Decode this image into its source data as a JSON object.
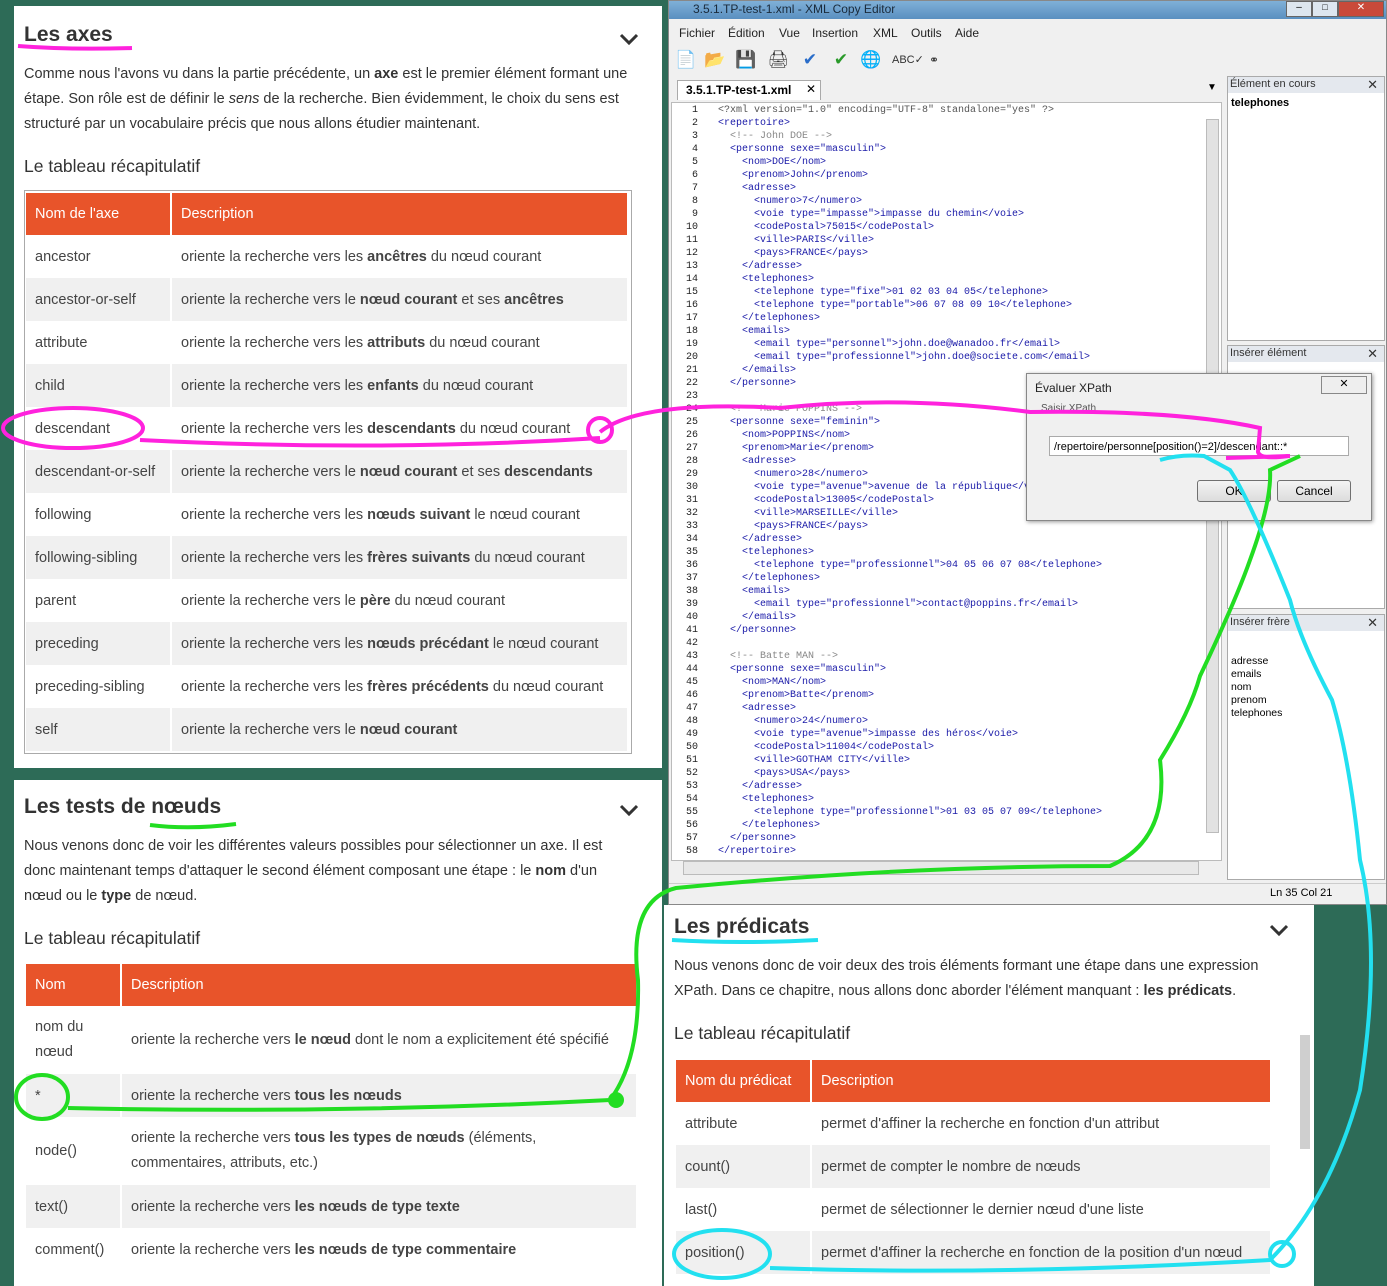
{
  "axes": {
    "title": "Les axes",
    "para1": "Comme nous l'avons vu dans la partie précédente, un",
    "para_bold1": "axe",
    "para2": "est le premier élément formant une étape. Son rôle est de définir le",
    "para_italic": "sens",
    "para3": "de la recherche. Bien évidemment, le choix du sens est structuré par un vocabulaire précis que nous allons étudier maintenant.",
    "subtitle": "Le tableau récapitulatif",
    "headers": [
      "Nom de l'axe",
      "Description"
    ],
    "rows": [
      [
        "ancestor",
        "oriente la recherche vers les ",
        "ancêtres",
        " du nœud courant",
        "",
        ""
      ],
      [
        "ancestor-or-self",
        "oriente la recherche vers le ",
        "nœud courant",
        " et ses ",
        "ancêtres",
        ""
      ],
      [
        "attribute",
        "oriente la recherche vers les ",
        "attributs",
        " du nœud courant",
        "",
        ""
      ],
      [
        "child",
        "oriente la recherche vers les ",
        "enfants",
        " du nœud courant",
        "",
        ""
      ],
      [
        "descendant",
        "oriente la recherche vers les ",
        "descendants",
        " du nœud courant",
        "",
        ""
      ],
      [
        "descendant-or-self",
        "oriente la recherche vers le ",
        "nœud courant",
        " et ses ",
        "descendants",
        ""
      ],
      [
        "following",
        "oriente la recherche vers les ",
        "nœuds suivant",
        " le nœud courant",
        "",
        ""
      ],
      [
        "following-sibling",
        "oriente la recherche vers les ",
        "frères suivants",
        " du nœud courant",
        "",
        ""
      ],
      [
        "parent",
        "oriente la recherche vers le ",
        "père",
        " du nœud courant",
        "",
        ""
      ],
      [
        "preceding",
        "oriente la recherche vers les ",
        "nœuds précédant",
        " le nœud courant",
        "",
        ""
      ],
      [
        "preceding-sibling",
        "oriente la recherche vers les ",
        "frères précédents",
        " du nœud courant",
        "",
        ""
      ],
      [
        "self",
        "oriente la recherche vers le ",
        "nœud courant",
        "",
        "",
        ""
      ]
    ]
  },
  "tests": {
    "title": "Les tests de nœuds",
    "para1": "Nous venons donc de voir les différentes valeurs possibles pour sélectionner un axe. Il est donc maintenant temps d'attaquer le second élément composant une étape : le",
    "bold_nom": "nom",
    "para2": "d'un nœud ou le",
    "bold_type": "type",
    "para3": "de nœud.",
    "subtitle": "Le tableau récapitulatif",
    "headers": [
      "Nom",
      "Description"
    ],
    "rows": [
      [
        "nom du nœud",
        "oriente la recherche vers ",
        "le nœud",
        " dont le nom a explicitement été spécifié"
      ],
      [
        "*",
        "oriente la recherche vers ",
        "tous les nœuds",
        ""
      ],
      [
        "node()",
        "oriente la recherche vers ",
        "tous les types de nœuds",
        " (éléments, commentaires, attributs, etc.)"
      ],
      [
        "text()",
        "oriente la recherche vers ",
        "les nœuds de type texte",
        ""
      ],
      [
        "comment()",
        "oriente la recherche vers ",
        "les nœuds de type commentaire",
        ""
      ]
    ]
  },
  "predicats": {
    "title": "Les prédicats",
    "para1": "Nous venons donc de voir deux des trois éléments formant une étape dans une expression XPath. Dans ce chapitre, nous allons donc aborder l'élément manquant :",
    "bold": "les prédicats",
    "para2": ".",
    "subtitle": "Le tableau récapitulatif",
    "headers": [
      "Nom du prédicat",
      "Description"
    ],
    "rows": [
      [
        "attribute",
        "permet d'affiner la recherche en fonction d'un attribut"
      ],
      [
        "count()",
        "permet de compter le nombre de nœuds"
      ],
      [
        "last()",
        "permet de sélectionner le dernier nœud d'une liste"
      ],
      [
        "position()",
        "permet d'affiner la recherche en fonction de la position d'un nœud"
      ]
    ]
  },
  "editor": {
    "window_title": "3.5.1.TP-test-1.xml - XML Copy Editor",
    "menu": [
      "Fichier",
      "Édition",
      "Vue",
      "Insertion",
      "XML",
      "Outils",
      "Aide"
    ],
    "tab_label": "3.5.1.TP-test-1.xml",
    "element_panel_title": "Élément en cours",
    "element_value": "telephones",
    "insert_panel_title": "Insérer élément",
    "sibling_panel_title": "Insérer frère",
    "sibling_items": [
      "adresse",
      "emails",
      "nom",
      "prenom",
      "telephones"
    ],
    "status": "Ln 35 Col 21",
    "lines": [
      "<?xml version=\"1.0\" encoding=\"UTF-8\" standalone=\"yes\" ?>",
      "<repertoire>",
      "  <!-- John DOE -->",
      "  <personne sexe=\"masculin\">",
      "    <nom>DOE</nom>",
      "    <prenom>John</prenom>",
      "    <adresse>",
      "      <numero>7</numero>",
      "      <voie type=\"impasse\">impasse du chemin</voie>",
      "      <codePostal>75015</codePostal>",
      "      <ville>PARIS</ville>",
      "      <pays>FRANCE</pays>",
      "    </adresse>",
      "    <telephones>",
      "      <telephone type=\"fixe\">01 02 03 04 05</telephone>",
      "      <telephone type=\"portable\">06 07 08 09 10</telephone>",
      "    </telephones>",
      "    <emails>",
      "      <email type=\"personnel\">john.doe@wanadoo.fr</email>",
      "      <email type=\"professionnel\">john.doe@societe.com</email>",
      "    </emails>",
      "  </personne>",
      "",
      "  <!-- Marie POPPINS -->",
      "  <personne sexe=\"feminin\">",
      "    <nom>POPPINS</nom>",
      "    <prenom>Marie</prenom>",
      "    <adresse>",
      "      <numero>28</numero>",
      "      <voie type=\"avenue\">avenue de la république</voie>",
      "      <codePostal>13005</codePostal>",
      "      <ville>MARSEILLE</ville>",
      "      <pays>FRANCE</pays>",
      "    </adresse>",
      "    <telephones>",
      "      <telephone type=\"professionnel\">04 05 06 07 08</telephone>",
      "    </telephones>",
      "    <emails>",
      "      <email type=\"professionnel\">contact@poppins.fr</email>",
      "    </emails>",
      "  </personne>",
      "",
      "  <!-- Batte MAN -->",
      "  <personne sexe=\"masculin\">",
      "    <nom>MAN</nom>",
      "    <prenom>Batte</prenom>",
      "    <adresse>",
      "      <numero>24</numero>",
      "      <voie type=\"avenue\">impasse des héros</voie>",
      "      <codePostal>11004</codePostal>",
      "      <ville>GOTHAM CITY</ville>",
      "      <pays>USA</pays>",
      "    </adresse>",
      "    <telephones>",
      "      <telephone type=\"professionnel\">01 03 05 07 09</telephone>",
      "    </telephones>",
      "  </personne>",
      "</repertoire>"
    ]
  },
  "dialog": {
    "title": "Évaluer XPath",
    "label": "Saisir XPath",
    "value": "/repertoire/personne[position()=2]/descendant::*",
    "ok": "OK",
    "cancel": "Cancel"
  },
  "colors": {
    "table_header": "#e8542a",
    "magenta_annotation": "#ff22dd",
    "green_annotation": "#22dd22",
    "cyan_annotation": "#22e0f0"
  }
}
